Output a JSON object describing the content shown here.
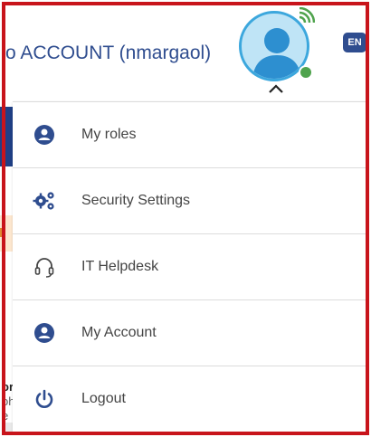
{
  "header": {
    "account_title": "o ACCOUNT (nmargaol)",
    "language_badge": "EN"
  },
  "menu": {
    "items": [
      {
        "label": "My roles",
        "icon": "user-circle-icon"
      },
      {
        "label": "Security Settings",
        "icon": "gears-icon"
      },
      {
        "label": "IT Helpdesk",
        "icon": "headset-icon"
      },
      {
        "label": "My Account",
        "icon": "user-circle-icon"
      },
      {
        "label": "Logout",
        "icon": "power-icon"
      }
    ]
  },
  "background": {
    "line1": "or",
    "line2": "oh",
    "line3": "e"
  },
  "colors": {
    "brand_blue": "#2f4d8f",
    "frame_red": "#c8141b",
    "avatar_ring": "#3ca7dd",
    "presence_green": "#4fa34d"
  }
}
